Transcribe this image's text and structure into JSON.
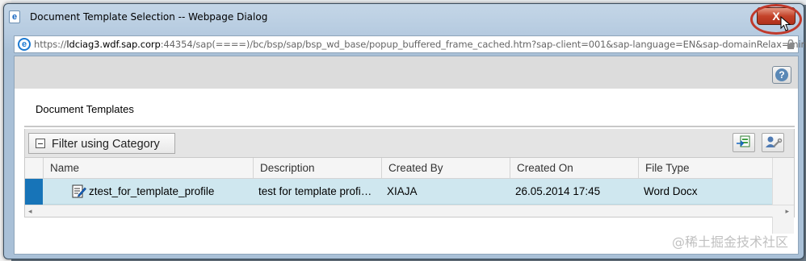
{
  "window": {
    "title": "Document Template Selection -- Webpage Dialog",
    "close_label": "X"
  },
  "address": {
    "url_prefix": "https://",
    "url_host": "ldciag3.wdf.sap.corp",
    "url_rest": ":44354/sap(====)/bc/bsp/sap/bsp_wd_base/popup_buffered_frame_cached.htm?sap-client=001&sap-language=EN&sap-domainRelax=min"
  },
  "content": {
    "section_title": "Document Templates",
    "filter_label": "Filter using Category",
    "columns": [
      "Name",
      "Description",
      "Created By",
      "Created On",
      "File Type"
    ],
    "rows": [
      {
        "name": "ztest_for_template_profile",
        "description": "test for template profi…",
        "created_by": "XIAJA",
        "created_on": "26.05.2014 17:45",
        "file_type": "Word Docx"
      }
    ]
  },
  "icons": {
    "title": "ie-page-icon",
    "address": "ie-logo-icon",
    "lock": "lock-icon",
    "help": "help-icon",
    "export": "export-icon",
    "personalize": "personalize-icon",
    "doc": "document-edit-icon"
  },
  "watermark": "@稀土掘金技术社区"
}
